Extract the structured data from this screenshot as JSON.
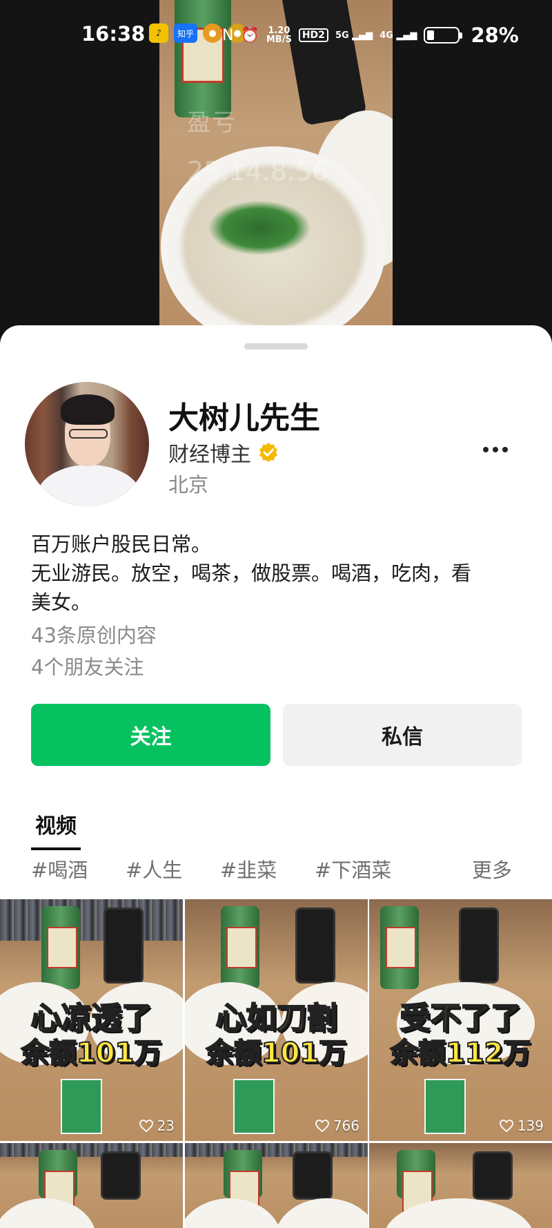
{
  "status_bar": {
    "time": "16:38",
    "icons": [
      "qq-music-icon",
      "zhihu-icon",
      "app-icon",
      "app-icon",
      "nfc-icon",
      "alarm-icon"
    ],
    "zhihu_label": "知乎",
    "speed_value": "1.20",
    "speed_unit": "MB/S",
    "hd_label": "HD2",
    "sig1_label": "5G",
    "sig2_label": "4G",
    "battery_percent": "28%"
  },
  "background_video": {
    "overlay_text": "盈亏",
    "overlay_number": "25.14.8.56"
  },
  "profile": {
    "name": "大树儿先生",
    "role": "财经博主",
    "verified_color": "#f5b800",
    "location": "北京",
    "bio_lines": [
      "百万账户股民日常。",
      "无业游民。放空，喝茶，做股票。喝酒，吃肉，看",
      "美女。"
    ],
    "original_count": "43条原创内容",
    "friends_follow": "4个朋友关注"
  },
  "actions": {
    "follow_label": "关注",
    "message_label": "私信",
    "follow_color": "#07c160"
  },
  "tabs": {
    "video_label": "视频"
  },
  "tags": [
    "#喝酒",
    "#人生",
    "#韭菜",
    "#下酒菜"
  ],
  "tags_more": "更多",
  "videos": [
    {
      "caption_line1": "心凉透了",
      "caption_line2": "余额101万",
      "likes": "23"
    },
    {
      "caption_line1": "心如刀割",
      "caption_line2": "余额101万",
      "likes": "766"
    },
    {
      "caption_line1": "受不了了",
      "caption_line2": "余额112万",
      "likes": "139"
    },
    {
      "caption_line1": "",
      "caption_line2": "",
      "likes": ""
    },
    {
      "caption_line1": "",
      "caption_line2": "",
      "likes": ""
    },
    {
      "caption_line1": "",
      "caption_line2": "",
      "likes": ""
    }
  ]
}
